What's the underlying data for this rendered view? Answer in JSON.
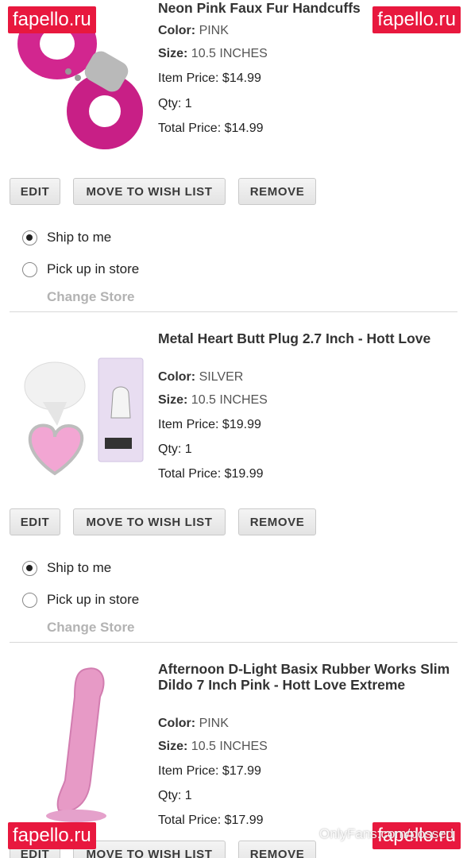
{
  "colors": {
    "brand_badge": "#e8183e",
    "button_bg": "#eaeaea",
    "muted": "#b3b3b3"
  },
  "buttons": {
    "edit": "EDIT",
    "wish": "MOVE TO WISH LIST",
    "remove": "REMOVE"
  },
  "shipping": {
    "ship_label": "Ship to me",
    "pickup_label": "Pick up in store",
    "change_store": "Change Store"
  },
  "labels": {
    "color": "Color:",
    "size": "Size:",
    "item_price": "Item Price:",
    "qty": "Qty:",
    "total_price": "Total Price:"
  },
  "items": [
    {
      "title": "Neon Pink Faux Fur Handcuffs",
      "color": "PINK",
      "size": "10.5 INCHES",
      "item_price": "$14.99",
      "qty": "1",
      "total_price": "$14.99",
      "image_icon": "handcuffs-image",
      "ship_selected": true
    },
    {
      "title": "Metal Heart Butt Plug 2.7 Inch - Hott Love",
      "color": "SILVER",
      "size": "10.5 INCHES",
      "item_price": "$19.99",
      "qty": "1",
      "total_price": "$19.99",
      "image_icon": "heart-plug-image",
      "ship_selected": true
    },
    {
      "title": "Afternoon D-Light Basix Rubber Works Slim Dildo 7 Inch Pink - Hott Love Extreme",
      "color": "PINK",
      "size": "10.5 INCHES",
      "item_price": "$17.99",
      "qty": "1",
      "total_price": "$17.99",
      "image_icon": "pink-toy-image",
      "ship_selected": false
    }
  ],
  "watermarks": {
    "badge": "fapello.ru",
    "footer": "OnlyFans.com/possed"
  }
}
